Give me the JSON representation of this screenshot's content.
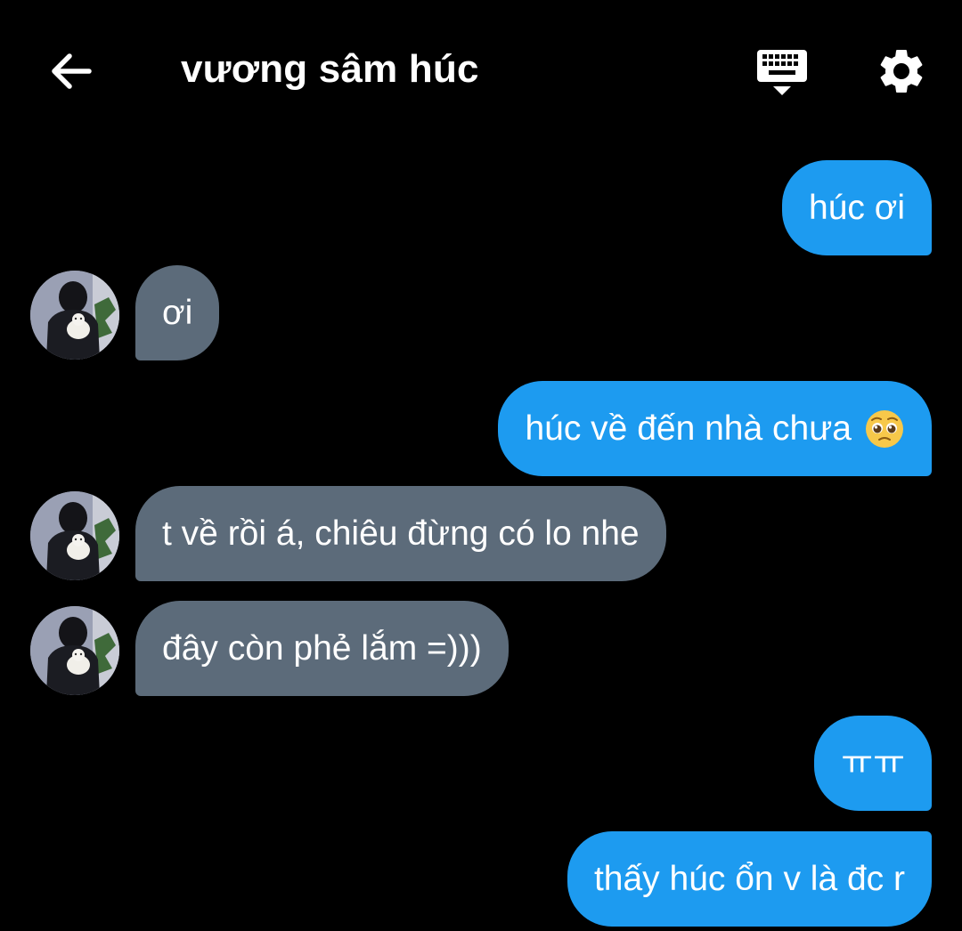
{
  "header": {
    "back_icon": "arrow-left-icon",
    "title": "vương sâm húc",
    "keyboard_icon": "keyboard-hide-icon",
    "settings_icon": "gear-icon"
  },
  "colors": {
    "background": "#000000",
    "outgoing_bubble": "#1d9bf0",
    "incoming_bubble": "#5c6b7a",
    "text": "#ffffff"
  },
  "messages": [
    {
      "direction": "out",
      "text": "húc ơi"
    },
    {
      "direction": "in",
      "text": "ơi"
    },
    {
      "direction": "out",
      "text": "húc về đến nhà chưa",
      "emoji": "pleading-face-icon"
    },
    {
      "direction": "in",
      "text": "t về rồi á, chiêu đừng có lo nhe"
    },
    {
      "direction": "in",
      "text": "đây còn phẻ lắm =)))"
    },
    {
      "direction": "out",
      "text": "ㅠㅠ"
    },
    {
      "direction": "out",
      "text": "thấy húc ổn v là đc r"
    }
  ]
}
